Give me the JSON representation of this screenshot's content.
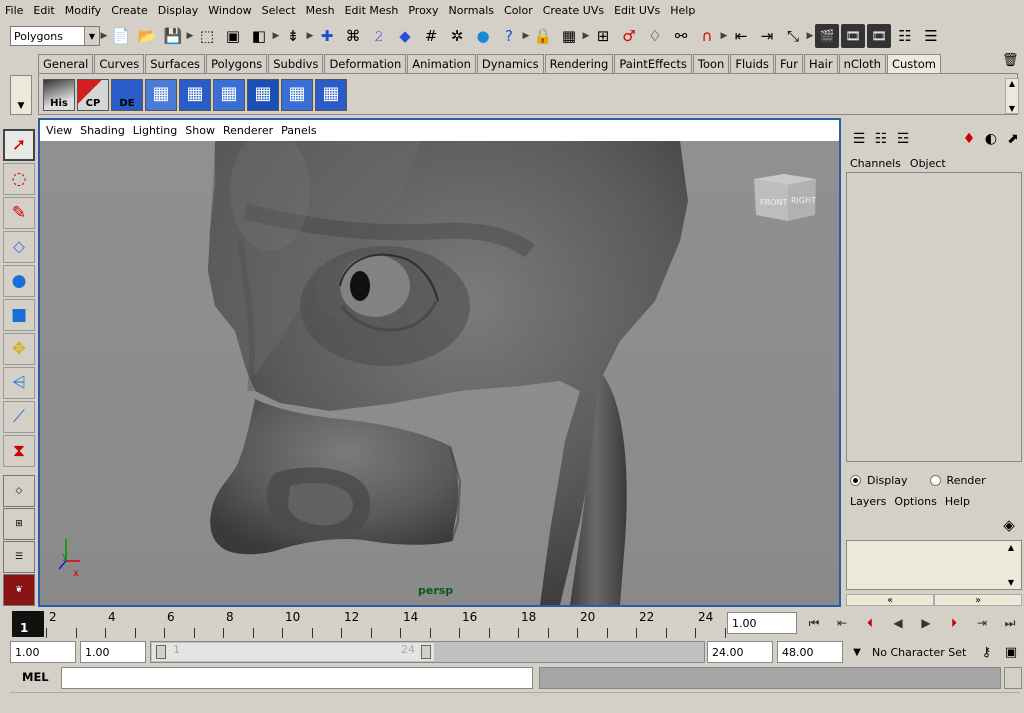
{
  "menubar": [
    "File",
    "Edit",
    "Modify",
    "Create",
    "Display",
    "Window",
    "Select",
    "Mesh",
    "Edit Mesh",
    "Proxy",
    "Normals",
    "Color",
    "Create UVs",
    "Edit UVs",
    "Help"
  ],
  "status_line": {
    "mode_select": "Polygons",
    "icons": [
      "new-scene-icon",
      "open-scene-icon",
      "save-scene-icon",
      "select-by-hierarchy-icon",
      "select-by-object-icon",
      "select-by-component-icon",
      "snap-grid-icon",
      "snap-curve-icon",
      "snap-point-icon",
      "snap-plane-icon",
      "make-live-icon",
      "history-icon",
      "render-icon",
      "ipr-render-icon",
      "render-settings-icon",
      "lock-icon",
      "show-manipulator-icon",
      "input-ops-icon",
      "construction-history-icon",
      "channel-icon",
      "hypershade-icon",
      "magnet-icon",
      "input-icon",
      "output-icon",
      "select-highlight-icon",
      "render-view-icon",
      "render-current-icon",
      "ipr-icon",
      "render-globals-icon",
      "show-hide-icon"
    ]
  },
  "shelf": {
    "tabs": [
      "General",
      "Curves",
      "Surfaces",
      "Polygons",
      "Subdivs",
      "Deformation",
      "Animation",
      "Dynamics",
      "Rendering",
      "PaintEffects",
      "Toon",
      "Fluids",
      "Fur",
      "Hair",
      "nCloth",
      "Custom"
    ],
    "active_tab": "Custom",
    "buttons": [
      {
        "name": "his-shelf-button",
        "label": "His"
      },
      {
        "name": "cp-shelf-button",
        "label": "CP"
      },
      {
        "name": "de-shelf-button",
        "label": "DE"
      },
      {
        "name": "uv-shelf-button-1",
        "label": ""
      },
      {
        "name": "uv-shelf-button-2",
        "label": ""
      },
      {
        "name": "uv-shelf-button-3",
        "label": ""
      },
      {
        "name": "uv-shelf-button-4",
        "label": ""
      },
      {
        "name": "uv-shelf-button-5",
        "label": ""
      },
      {
        "name": "uv-shelf-button-6",
        "label": ""
      }
    ]
  },
  "viewport": {
    "menu": [
      "View",
      "Shading",
      "Lighting",
      "Show",
      "Renderer",
      "Panels"
    ],
    "camera": "persp",
    "view_cube": {
      "front": "FRONT",
      "right": "RIGHT"
    },
    "axes": {
      "x": "x",
      "y": "y"
    }
  },
  "channel_box": {
    "menu": [
      "Channels",
      "Object"
    ]
  },
  "layer_editor": {
    "radio_display": "Display",
    "radio_render": "Render",
    "selected": "Display",
    "menu": [
      "Layers",
      "Options",
      "Help"
    ]
  },
  "time_slider": {
    "current_frame": "1",
    "ticks": [
      "2",
      "4",
      "6",
      "8",
      "10",
      "12",
      "14",
      "16",
      "18",
      "20",
      "22",
      "24"
    ],
    "current_time": "1.00"
  },
  "range_slider": {
    "start_time": "1.00",
    "playback_start": "1.00",
    "range_start_label": "1",
    "range_end_label": "24",
    "playback_end": "24.00",
    "end_time": "48.00"
  },
  "character_set": "No Character Set",
  "command_line": {
    "label": "MEL",
    "value": ""
  },
  "help_line": ""
}
